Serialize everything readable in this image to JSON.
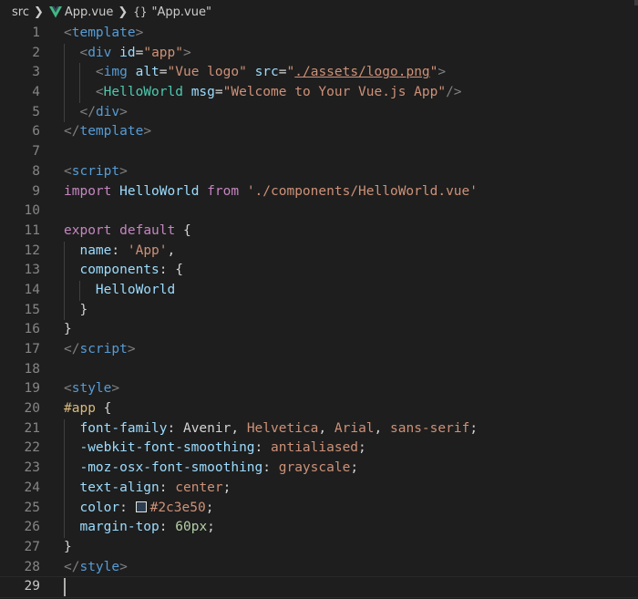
{
  "breadcrumb": {
    "folder": "src",
    "file": "App.vue",
    "symbol": "\"App.vue\""
  },
  "colors": {
    "background": "#1e1e1e",
    "line_number": "#858585",
    "vue_green": "#41b883",
    "swatch": "#2c3e50"
  },
  "active_line": 29,
  "lines": [
    {
      "n": "1",
      "indent": 0,
      "t": [
        [
          "<",
          "punc"
        ],
        [
          "template",
          "tag"
        ],
        [
          ">",
          "punc"
        ]
      ]
    },
    {
      "n": "2",
      "indent": 1,
      "t": [
        [
          "  ",
          "text"
        ],
        [
          "<",
          "punc"
        ],
        [
          "div",
          "tag"
        ],
        [
          " ",
          "text"
        ],
        [
          "id",
          "attr"
        ],
        [
          "=",
          "text"
        ],
        [
          "\"app\"",
          "str"
        ],
        [
          ">",
          "punc"
        ]
      ]
    },
    {
      "n": "3",
      "indent": 2,
      "t": [
        [
          "    ",
          "text"
        ],
        [
          "<",
          "punc"
        ],
        [
          "img",
          "tag"
        ],
        [
          " ",
          "text"
        ],
        [
          "alt",
          "attr"
        ],
        [
          "=",
          "text"
        ],
        [
          "\"Vue logo\"",
          "str"
        ],
        [
          " ",
          "text"
        ],
        [
          "src",
          "attr"
        ],
        [
          "=",
          "text"
        ],
        [
          "\"",
          "str"
        ],
        [
          "./assets/logo.png",
          "str-link"
        ],
        [
          "\"",
          "str"
        ],
        [
          ">",
          "punc"
        ]
      ]
    },
    {
      "n": "4",
      "indent": 2,
      "t": [
        [
          "    ",
          "text"
        ],
        [
          "<",
          "punc"
        ],
        [
          "HelloWorld",
          "comp"
        ],
        [
          " ",
          "text"
        ],
        [
          "msg",
          "attr"
        ],
        [
          "=",
          "text"
        ],
        [
          "\"Welcome to Your Vue.js App\"",
          "str"
        ],
        [
          "/>",
          "punc"
        ]
      ]
    },
    {
      "n": "5",
      "indent": 1,
      "t": [
        [
          "  ",
          "text"
        ],
        [
          "</",
          "punc"
        ],
        [
          "div",
          "tag"
        ],
        [
          ">",
          "punc"
        ]
      ]
    },
    {
      "n": "6",
      "indent": 0,
      "t": [
        [
          "</",
          "punc"
        ],
        [
          "template",
          "tag"
        ],
        [
          ">",
          "punc"
        ]
      ]
    },
    {
      "n": "7",
      "indent": 0,
      "t": []
    },
    {
      "n": "8",
      "indent": 0,
      "t": [
        [
          "<",
          "punc"
        ],
        [
          "script",
          "tag"
        ],
        [
          ">",
          "punc"
        ]
      ]
    },
    {
      "n": "9",
      "indent": 0,
      "t": [
        [
          "import",
          "kw"
        ],
        [
          " ",
          "text"
        ],
        [
          "HelloWorld",
          "var"
        ],
        [
          " ",
          "text"
        ],
        [
          "from",
          "kw"
        ],
        [
          " ",
          "text"
        ],
        [
          "'./components/HelloWorld.vue'",
          "str"
        ]
      ]
    },
    {
      "n": "10",
      "indent": 0,
      "t": []
    },
    {
      "n": "11",
      "indent": 0,
      "t": [
        [
          "export",
          "kw"
        ],
        [
          " ",
          "text"
        ],
        [
          "default",
          "kw"
        ],
        [
          " {",
          "text"
        ]
      ]
    },
    {
      "n": "12",
      "indent": 1,
      "t": [
        [
          "  ",
          "text"
        ],
        [
          "name",
          "var"
        ],
        [
          ": ",
          "text"
        ],
        [
          "'App'",
          "str"
        ],
        [
          ",",
          "text"
        ]
      ]
    },
    {
      "n": "13",
      "indent": 1,
      "t": [
        [
          "  ",
          "text"
        ],
        [
          "components",
          "var"
        ],
        [
          ": {",
          "text"
        ]
      ]
    },
    {
      "n": "14",
      "indent": 2,
      "t": [
        [
          "    ",
          "text"
        ],
        [
          "HelloWorld",
          "var"
        ]
      ]
    },
    {
      "n": "15",
      "indent": 1,
      "t": [
        [
          "  }",
          "text"
        ]
      ]
    },
    {
      "n": "16",
      "indent": 0,
      "t": [
        [
          "}",
          "text"
        ]
      ]
    },
    {
      "n": "17",
      "indent": 0,
      "t": [
        [
          "</",
          "punc"
        ],
        [
          "script",
          "tag"
        ],
        [
          ">",
          "punc"
        ]
      ]
    },
    {
      "n": "18",
      "indent": 0,
      "t": []
    },
    {
      "n": "19",
      "indent": 0,
      "t": [
        [
          "<",
          "punc"
        ],
        [
          "style",
          "tag"
        ],
        [
          ">",
          "punc"
        ]
      ]
    },
    {
      "n": "20",
      "indent": 0,
      "t": [
        [
          "#app",
          "sel"
        ],
        [
          " {",
          "text"
        ]
      ]
    },
    {
      "n": "21",
      "indent": 1,
      "t": [
        [
          "  ",
          "text"
        ],
        [
          "font-family",
          "var"
        ],
        [
          ": ",
          "text"
        ],
        [
          "Avenir",
          "text"
        ],
        [
          ", ",
          "text"
        ],
        [
          "Helvetica",
          "str"
        ],
        [
          ", ",
          "text"
        ],
        [
          "Arial",
          "str"
        ],
        [
          ", ",
          "text"
        ],
        [
          "sans-serif",
          "str"
        ],
        [
          ";",
          "text"
        ]
      ]
    },
    {
      "n": "22",
      "indent": 1,
      "t": [
        [
          "  ",
          "text"
        ],
        [
          "-webkit-font-smoothing",
          "var"
        ],
        [
          ": ",
          "text"
        ],
        [
          "antialiased",
          "str"
        ],
        [
          ";",
          "text"
        ]
      ]
    },
    {
      "n": "23",
      "indent": 1,
      "t": [
        [
          "  ",
          "text"
        ],
        [
          "-moz-osx-font-smoothing",
          "var"
        ],
        [
          ": ",
          "text"
        ],
        [
          "grayscale",
          "str"
        ],
        [
          ";",
          "text"
        ]
      ]
    },
    {
      "n": "24",
      "indent": 1,
      "t": [
        [
          "  ",
          "text"
        ],
        [
          "text-align",
          "var"
        ],
        [
          ": ",
          "text"
        ],
        [
          "center",
          "str"
        ],
        [
          ";",
          "text"
        ]
      ]
    },
    {
      "n": "25",
      "indent": 1,
      "t": [
        [
          "  ",
          "text"
        ],
        [
          "color",
          "var"
        ],
        [
          ": ",
          "text"
        ],
        [
          "",
          "swatch"
        ],
        [
          "#2c3e50",
          "str"
        ],
        [
          ";",
          "text"
        ]
      ]
    },
    {
      "n": "26",
      "indent": 1,
      "t": [
        [
          "  ",
          "text"
        ],
        [
          "margin-top",
          "var"
        ],
        [
          ": ",
          "text"
        ],
        [
          "60px",
          "num"
        ],
        [
          ";",
          "text"
        ]
      ]
    },
    {
      "n": "27",
      "indent": 0,
      "t": [
        [
          "}",
          "text"
        ]
      ]
    },
    {
      "n": "28",
      "indent": 0,
      "t": [
        [
          "</",
          "punc"
        ],
        [
          "style",
          "tag"
        ],
        [
          ">",
          "punc"
        ]
      ]
    },
    {
      "n": "29",
      "indent": 0,
      "t": []
    }
  ]
}
